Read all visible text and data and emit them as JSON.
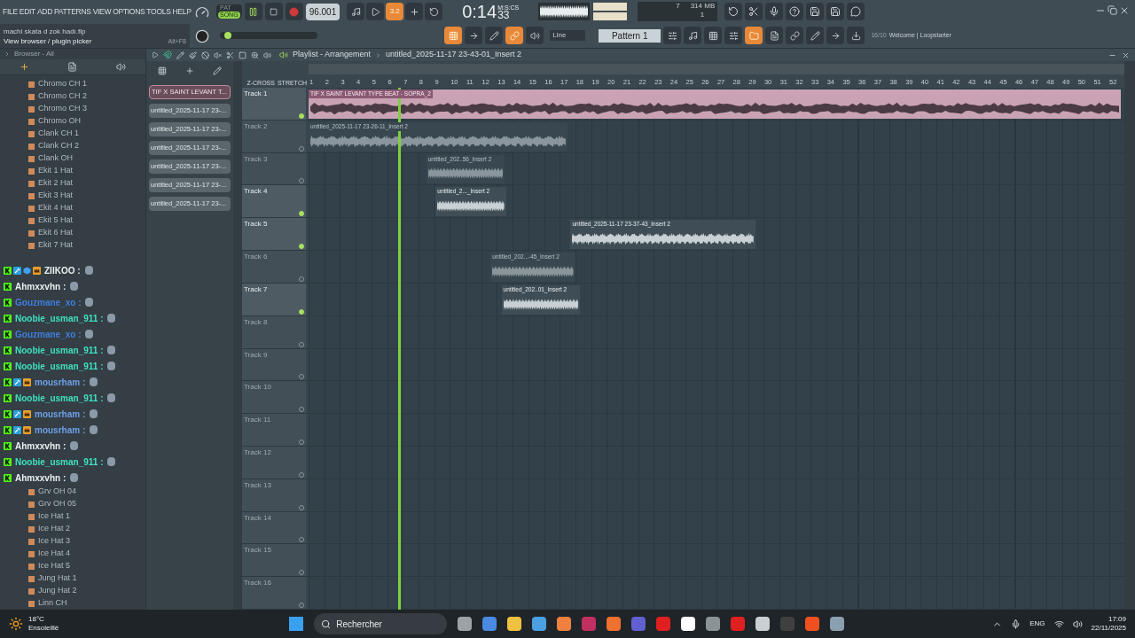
{
  "menu": [
    "FILE",
    "EDIT",
    "ADD",
    "PATTERNS",
    "VIEW",
    "OPTIONS",
    "TOOLS",
    "HELP"
  ],
  "project_file": "machi skata d zok hadı.flp",
  "hint": {
    "text": "View browser / plugin picker",
    "shortcut": "Alt+F8"
  },
  "mode_toggle": [
    {
      "label": "PAT",
      "selected": false
    },
    {
      "label": "SONG",
      "selected": true
    }
  ],
  "tempo": "96.001",
  "countdown": "3.2",
  "pitch": {
    "level": 0.05
  },
  "time": {
    "value": "0:14",
    "cs": "33",
    "unit": "M:S:CS"
  },
  "cpu": {
    "voices": "7",
    "memory": "314 MB",
    "polyphony": "1"
  },
  "snap": "Line",
  "pattern": "Pattern 1",
  "news": {
    "count": "16/10",
    "text": "Welcome | Loopstarter"
  },
  "browser": {
    "title": "Browser - All",
    "items_top": [
      "Chromo CH 1",
      "Chromo CH 2",
      "Chromo CH 3",
      "Chromo OH",
      "Clank CH 1",
      "Clank CH 2",
      "Clank OH",
      "Ekit 1 Hat",
      "Ekit 2 Hat",
      "Ekit 3 Hat",
      "Ekit 4 Hat",
      "Ekit 5 Hat",
      "Ekit 6 Hat",
      "Ekit 7 Hat"
    ],
    "items_bottom": [
      "Grv OH 04",
      "Grv OH 05",
      "Ice Hat 1",
      "Ice Hat 2",
      "Ice Hat 3",
      "Ice Hat 4",
      "Ice Hat 5",
      "Jung Hat 1",
      "Jung Hat 2",
      "Linn CH"
    ]
  },
  "chat_overlay": [
    {
      "name": "ZIIKOO :",
      "color": "#e8f0f0",
      "badges": [
        {
          "kind": "platform"
        },
        {
          "kind": "mod"
        },
        {
          "kind": "cube"
        },
        {
          "kind": "crown"
        }
      ]
    },
    {
      "name": "Ahmxxvhn :",
      "color": "#e8f0f0",
      "badges": [
        {
          "kind": "platform"
        }
      ]
    },
    {
      "name": "Gouzmane_xo :",
      "color": "#3f7fe0",
      "badges": [
        {
          "kind": "platform"
        }
      ]
    },
    {
      "name": "Noobie_usman_911 :",
      "color": "#3fe0c0",
      "badges": [
        {
          "kind": "platform"
        }
      ]
    },
    {
      "name": "Gouzmane_xo :",
      "color": "#3f7fe0",
      "badges": [
        {
          "kind": "platform"
        }
      ]
    },
    {
      "name": "Noobie_usman_911 :",
      "color": "#3fe0c0",
      "badges": [
        {
          "kind": "platform"
        }
      ]
    },
    {
      "name": "Noobie_usman_911 :",
      "color": "#3fe0c0",
      "badges": [
        {
          "kind": "platform"
        }
      ]
    },
    {
      "name": "mousrham :",
      "color": "#6f9fe8",
      "badges": [
        {
          "kind": "platform"
        },
        {
          "kind": "mod"
        },
        {
          "kind": "crown"
        }
      ]
    },
    {
      "name": "Noobie_usman_911 :",
      "color": "#3fe0c0",
      "badges": [
        {
          "kind": "platform"
        }
      ]
    },
    {
      "name": "mousrham :",
      "color": "#6f9fe8",
      "badges": [
        {
          "kind": "platform"
        },
        {
          "kind": "mod"
        },
        {
          "kind": "crown"
        }
      ]
    },
    {
      "name": "mousrham :",
      "color": "#6f9fe8",
      "badges": [
        {
          "kind": "platform"
        },
        {
          "kind": "mod"
        },
        {
          "kind": "crown"
        }
      ]
    },
    {
      "name": "Ahmxxvhn :",
      "color": "#e8f0f0",
      "badges": [
        {
          "kind": "platform"
        }
      ]
    },
    {
      "name": "Noobie_usman_911 :",
      "color": "#3fe0c0",
      "badges": [
        {
          "kind": "platform"
        }
      ]
    },
    {
      "name": "Ahmxxvhn :",
      "color": "#e8f0f0",
      "badges": [
        {
          "kind": "platform"
        }
      ]
    }
  ],
  "playlist": {
    "title": "Playlist - Arrangement",
    "clip_name": "untitled_2025-11-17 23-43-01_Insert 2",
    "z_cross": "Z-CROSS",
    "stretch": "STRETCH",
    "patterns": [
      {
        "label": "TIF X SAINT LEVANT T...",
        "selected": true
      },
      {
        "label": "untitled_2025-11-17 23-...",
        "selected": false
      },
      {
        "label": "untitled_2025-11-17 23-...",
        "selected": false
      },
      {
        "label": "untitled_2025-11-17 23-...",
        "selected": false
      },
      {
        "label": "untitled_2025-11-17 23-...",
        "selected": false
      },
      {
        "label": "untitled_2025-11-17 23-...",
        "selected": false
      },
      {
        "label": "untitled_2025-11-17 23-...",
        "selected": false
      }
    ],
    "ruler": [
      "1",
      "2",
      "3",
      "4",
      "5",
      "6",
      "7",
      "8",
      "9",
      "10",
      "11",
      "12",
      "13",
      "14",
      "15",
      "16",
      "17",
      "18",
      "19",
      "20",
      "21",
      "22",
      "23",
      "24",
      "25",
      "26",
      "27",
      "28",
      "29",
      "30",
      "31",
      "32",
      "33",
      "34",
      "35",
      "36",
      "37",
      "38",
      "39",
      "40",
      "41",
      "42",
      "43",
      "44",
      "45",
      "46",
      "47",
      "48",
      "49",
      "50",
      "51",
      "52"
    ],
    "tracks": [
      {
        "name": "Track 1",
        "enabled": true,
        "clip": {
          "label": "TIF X SAINT LEVANT TYPE BEAT - SOPRA_2",
          "kind": "main",
          "muted": false
        }
      },
      {
        "name": "Track 2",
        "enabled": false,
        "clip": {
          "label": "untitled_2025-11-17 23-26-11_Insert 2",
          "kind": "audio",
          "muted": true
        }
      },
      {
        "name": "Track 3",
        "enabled": false,
        "clip": {
          "label": "untitled_202..56_Insert 2",
          "kind": "audio",
          "muted": true
        }
      },
      {
        "name": "Track 4",
        "enabled": true,
        "clip": {
          "label": "untitled_2..._Insert 2",
          "kind": "audio",
          "muted": false
        }
      },
      {
        "name": "Track 5",
        "enabled": true,
        "clip": {
          "label": "untitled_2025-11-17 23-37-43_Insert 2",
          "kind": "audio",
          "muted": false
        }
      },
      {
        "name": "Track 6",
        "enabled": false,
        "clip": {
          "label": "untitled_202...-45_Insert 2",
          "kind": "audio",
          "muted": true
        }
      },
      {
        "name": "Track 7",
        "enabled": true,
        "clip": {
          "label": "untitled_202..01_Insert 2",
          "kind": "audio",
          "muted": false
        }
      },
      {
        "name": "Track 8",
        "enabled": false
      },
      {
        "name": "Track 9",
        "enabled": false
      },
      {
        "name": "Track 10",
        "enabled": false
      },
      {
        "name": "Track 11",
        "enabled": false
      },
      {
        "name": "Track 12",
        "enabled": false
      },
      {
        "name": "Track 13",
        "enabled": false
      },
      {
        "name": "Track 14",
        "enabled": false
      },
      {
        "name": "Track 15",
        "enabled": false
      },
      {
        "name": "Track 16",
        "enabled": false
      }
    ]
  },
  "taskbar": {
    "temperature": "18°C",
    "weather": "Ensoleillé",
    "search": "Rechercher",
    "language": "ENG",
    "time": "17:09",
    "date": "22/11/2025"
  }
}
